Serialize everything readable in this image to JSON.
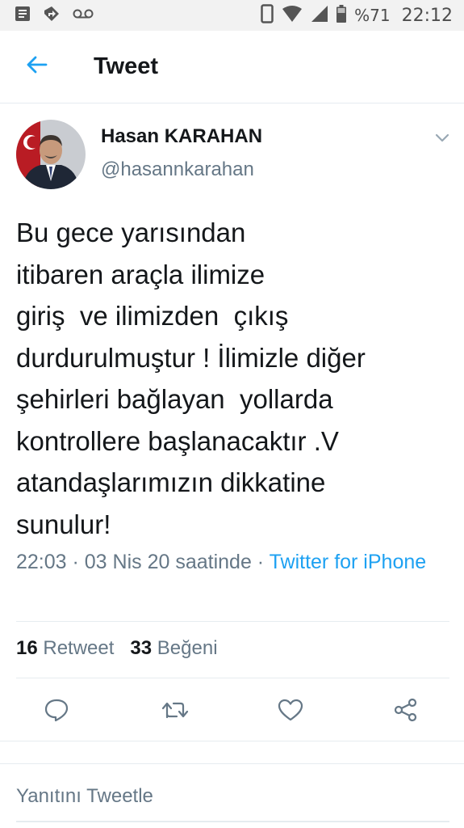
{
  "status_bar": {
    "icons": [
      "notes-icon",
      "location-off-icon",
      "voicemail-icon",
      "phone-vibrate-icon",
      "wifi-icon",
      "signal-icon",
      "battery-icon"
    ],
    "battery": "%71",
    "time": "22:12"
  },
  "header": {
    "title": "Tweet"
  },
  "tweet": {
    "author_name": "Hasan KARAHAN",
    "author_handle": "@hasannkarahan",
    "text_lines": [
      "Bu gece yarısından",
      "itibaren araçla ilimize",
      "giriş  ve ilimizden  çıkış",
      "durdurulmuştur ! İlimizle diğer",
      "şehirleri bağlayan  yollarda",
      "kontrollere başlanacaktır .V",
      "atandaşlarımızın dikkatine",
      "sunulur!"
    ],
    "timestamp": "22:03 · 03 Nis 20 saatinde · ",
    "source": "Twitter for iPhone"
  },
  "stats": {
    "retweets_count": "16",
    "retweets_label": "Retweet",
    "likes_count": "33",
    "likes_label": "Beğeni"
  },
  "actions": [
    "reply-icon",
    "retweet-icon",
    "like-icon",
    "share-icon"
  ],
  "reply": {
    "placeholder": "Yanıtını Tweetle"
  },
  "colors": {
    "accent": "#1da1f2",
    "secondary_text": "#657786",
    "divider": "#e6ecf0",
    "status_bar_bg": "#f2f2f2"
  }
}
